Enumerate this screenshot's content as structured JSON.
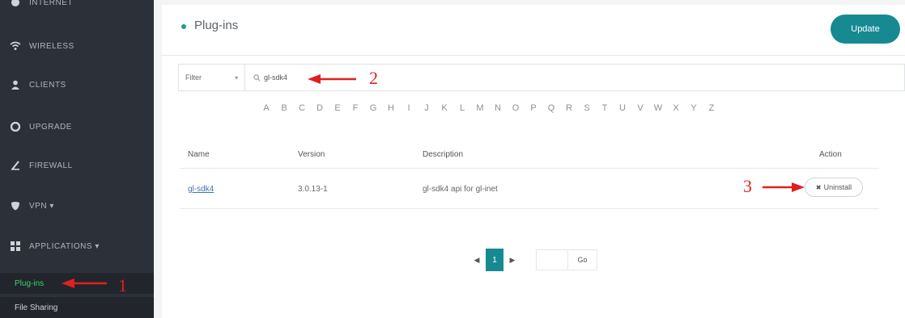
{
  "sidebar": {
    "items": [
      {
        "label": "INTERNET",
        "icon": "globe-icon"
      },
      {
        "label": "WIRELESS",
        "icon": "wifi-icon"
      },
      {
        "label": "CLIENTS",
        "icon": "user-icon"
      },
      {
        "label": "UPGRADE",
        "icon": "upgrade-icon"
      },
      {
        "label": "FIREWALL",
        "icon": "firewall-icon"
      },
      {
        "label": "VPN ▾",
        "icon": "shield-icon"
      },
      {
        "label": "APPLICATIONS ▾",
        "icon": "grid-icon"
      }
    ],
    "subitems": [
      {
        "label": "Plug-ins",
        "active": true
      },
      {
        "label": "File Sharing",
        "active": false
      }
    ]
  },
  "header": {
    "title": "Plug-ins",
    "update_label": "Update"
  },
  "filter": {
    "select_label": "Filter",
    "search_value": "gl-sdk4"
  },
  "letters": [
    "A",
    "B",
    "C",
    "D",
    "E",
    "F",
    "G",
    "H",
    "I",
    "J",
    "K",
    "L",
    "M",
    "N",
    "O",
    "P",
    "Q",
    "R",
    "S",
    "T",
    "U",
    "V",
    "W",
    "X",
    "Y",
    "Z"
  ],
  "table": {
    "headers": {
      "name": "Name",
      "version": "Version",
      "description": "Description",
      "action": "Action"
    },
    "rows": [
      {
        "name": "gl-sdk4",
        "version": "3.0.13-1",
        "description": "gl-sdk4 api for gl-inet",
        "action": "Uninstall"
      }
    ]
  },
  "pagination": {
    "prev": "◀",
    "current": "1",
    "next": "▶",
    "go_label": "Go"
  },
  "annotations": {
    "one": "1",
    "two": "2",
    "three": "3"
  },
  "colors": {
    "sidebar_bg": "#2c3039",
    "accent": "#178a91",
    "active_green": "#3fd26b",
    "annotation_red": "#e02020"
  }
}
